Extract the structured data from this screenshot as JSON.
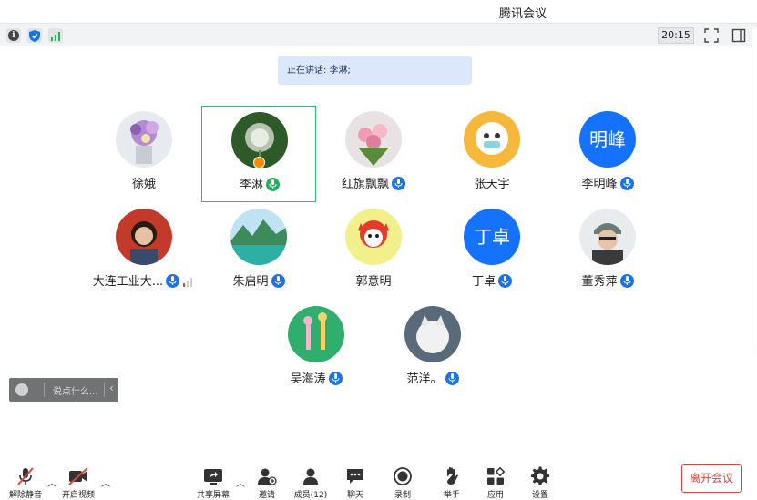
{
  "window": {
    "title": "腾讯会议"
  },
  "statusbar": {
    "timer": "20:15"
  },
  "speaking": {
    "text": "正在讲话: 李淋;"
  },
  "participants": [
    {
      "name": "徐娥",
      "avatar": "flowers-photo"
    },
    {
      "name": "李淋",
      "avatar": "dandelion-photo",
      "active": true,
      "host": true
    },
    {
      "name": "红旗飘飘",
      "avatar": "pink-flowers-photo"
    },
    {
      "name": "张天宇",
      "avatar": "cartoon-photo"
    },
    {
      "name": "李明峰",
      "avatar_text": "明峰"
    },
    {
      "name": "大连工业大...",
      "avatar": "woman-photo"
    },
    {
      "name": "朱启明",
      "avatar": "landscape-photo"
    },
    {
      "name": "郭意明",
      "avatar": "cartoon-fox"
    },
    {
      "name": "丁卓",
      "avatar_text": "丁卓"
    },
    {
      "name": "董秀萍",
      "avatar": "man-photo"
    },
    {
      "name": "吴海涛",
      "avatar": "deer-photo"
    },
    {
      "name": "范洋。",
      "avatar": "cat-photo"
    }
  ],
  "chat": {
    "placeholder": "说点什么..."
  },
  "toolbar": {
    "unmute": "解除静音",
    "video": "开启视频",
    "share": "共享屏幕",
    "invite": "邀请",
    "members": "成员(12)",
    "chat": "聊天",
    "record": "录制",
    "raise_hand": "举手",
    "apps": "应用",
    "settings": "设置",
    "leave": "离开会议"
  },
  "colors": {
    "accent": "#1472ff",
    "active_border": "#2bbd6c",
    "leave": "#e0443e"
  }
}
